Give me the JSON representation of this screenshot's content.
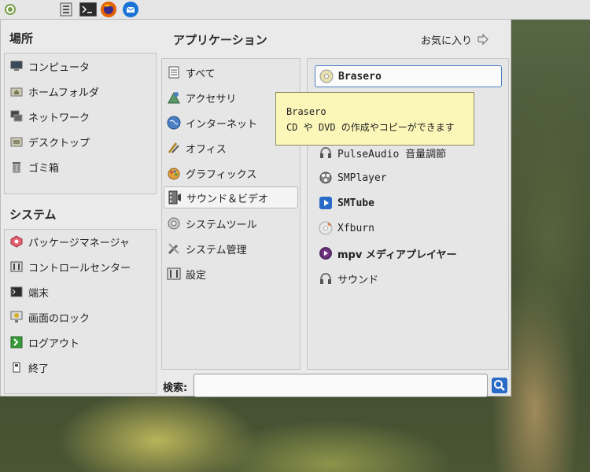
{
  "taskbar": {
    "icons": [
      "mint-menu-icon",
      "file-manager-icon",
      "terminal-icon",
      "firefox-icon",
      "thunderbird-icon"
    ]
  },
  "places": {
    "heading": "場所",
    "items": [
      {
        "label": "コンピュータ",
        "icon": "computer-icon"
      },
      {
        "label": "ホームフォルダ",
        "icon": "home-folder-icon"
      },
      {
        "label": "ネットワーク",
        "icon": "network-icon"
      },
      {
        "label": "デスクトップ",
        "icon": "desktop-icon"
      },
      {
        "label": "ゴミ箱",
        "icon": "trash-icon"
      }
    ]
  },
  "system": {
    "heading": "システム",
    "items": [
      {
        "label": "パッケージマネージャ",
        "icon": "package-manager-icon"
      },
      {
        "label": "コントロールセンター",
        "icon": "control-center-icon"
      },
      {
        "label": "端末",
        "icon": "terminal-icon"
      },
      {
        "label": "画面のロック",
        "icon": "lock-screen-icon"
      },
      {
        "label": "ログアウト",
        "icon": "logout-icon"
      },
      {
        "label": "終了",
        "icon": "shutdown-icon"
      }
    ]
  },
  "applications": {
    "heading": "アプリケーション",
    "favorites_label": "お気に入り",
    "categories": [
      {
        "label": "すべて",
        "icon": "all-apps-icon"
      },
      {
        "label": "アクセサリ",
        "icon": "accessories-icon"
      },
      {
        "label": "インターネット",
        "icon": "internet-icon"
      },
      {
        "label": "オフィス",
        "icon": "office-icon"
      },
      {
        "label": "グラフィックス",
        "icon": "graphics-icon"
      },
      {
        "label": "サウンド＆ビデオ",
        "icon": "sound-video-icon"
      },
      {
        "label": "システムツール",
        "icon": "system-tools-icon"
      },
      {
        "label": "システム管理",
        "icon": "administration-icon"
      },
      {
        "label": "設定",
        "icon": "settings-icon"
      }
    ],
    "selected_category": "サウンド＆ビデオ",
    "apps": [
      {
        "label": "Brasero",
        "icon": "brasero-icon"
      },
      {
        "label": "PulseAudio 音量調節",
        "icon": "pulseaudio-icon"
      },
      {
        "label": "SMPlayer",
        "icon": "smplayer-icon"
      },
      {
        "label": "SMTube",
        "icon": "smtube-icon"
      },
      {
        "label": "Xfburn",
        "icon": "xfburn-icon"
      },
      {
        "label": "mpv メディアプレイヤー",
        "icon": "mpv-icon"
      },
      {
        "label": "サウンド",
        "icon": "sound-icon"
      }
    ]
  },
  "tooltip": {
    "title": "Brasero",
    "description": "CD や DVD の作成やコピーができます"
  },
  "search": {
    "label": "検索:",
    "value": "",
    "placeholder": ""
  },
  "colors": {
    "menu_bg": "#eaeaea",
    "tooltip_bg": "#fbf7b9",
    "accent_blue": "#4a7fc4"
  }
}
